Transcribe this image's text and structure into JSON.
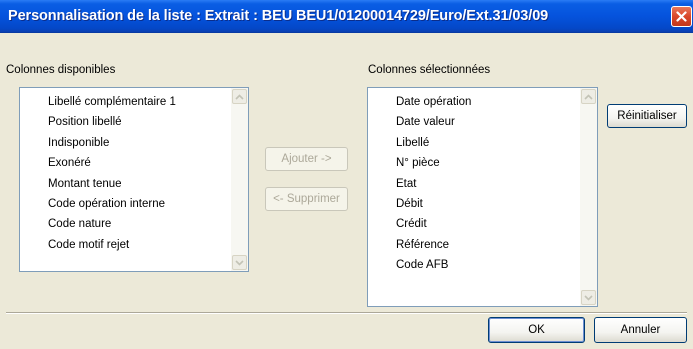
{
  "window": {
    "title": "Personnalisation de la liste : Extrait : BEU BEU1/01200014729/Euro/Ext.31/03/09"
  },
  "available": {
    "label": "Colonnes disponibles",
    "items": [
      "Libellé complémentaire 1",
      "Position libellé",
      "Indisponible",
      "Exonéré",
      "Montant tenue",
      "Code opération interne",
      "Code nature",
      "Code motif rejet"
    ]
  },
  "selected": {
    "label": "Colonnes sélectionnées",
    "items": [
      "Date opération",
      "Date valeur",
      "Libellé",
      "N° pièce",
      "Etat",
      "Débit",
      "Crédit",
      "Référence",
      "Code AFB"
    ]
  },
  "buttons": {
    "add": "Ajouter ->",
    "remove": "<- Supprimer",
    "reset": "Réinitialiser",
    "ok": "OK",
    "cancel": "Annuler"
  },
  "colors": {
    "titlebar": "#0553dd",
    "dialog": "#ece9d8",
    "close": "#d9472a"
  }
}
